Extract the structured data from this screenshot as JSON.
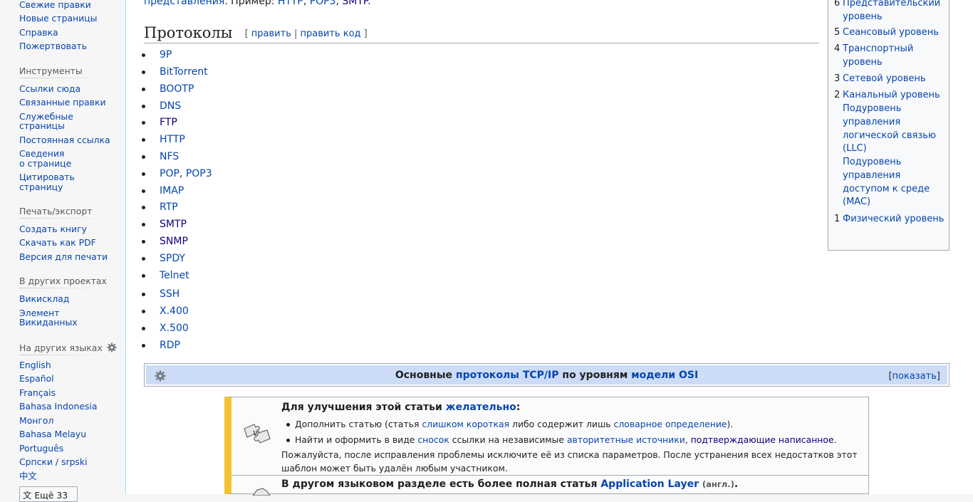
{
  "sidebar": {
    "nav": [
      "Свежие правки",
      "Новые страницы",
      "Справка",
      "Пожертвовать"
    ],
    "tools_heading": "Инструменты",
    "tools": [
      "Ссылки сюда",
      "Связанные правки",
      "Служебные",
      "страницы",
      "Постоянная ссылка",
      "Сведения",
      "о странице",
      "Цитировать",
      "страницу"
    ],
    "print_heading": "Печать/экспорт",
    "print": [
      "Создать книгу",
      "Скачать как PDF",
      "Версия для печати"
    ],
    "projects_heading": "В других проектах",
    "projects": [
      "Викисклад",
      "Элемент",
      "Викиданных"
    ],
    "languages_heading": "На других языках",
    "languages": [
      "English",
      "Español",
      "Français",
      "Bahasa Indonesia",
      "Монгол",
      "Bahasa Melayu",
      "Português",
      "Српски / srpski",
      "中文"
    ],
    "more_languages": "Ещё 33"
  },
  "intro": {
    "link1": "представления",
    "text": ". Пример: ",
    "link2": "HTTP",
    "sep1": ", ",
    "link3": "POP3",
    "sep2": ", ",
    "link4": "SMTP",
    "end": "."
  },
  "section": {
    "title": "Протоколы",
    "edit_open": "[ ",
    "edit": "править",
    "edit_sep": " | ",
    "edit_code": "править код",
    "edit_close": " ]"
  },
  "protocols": [
    "9P",
    "BitTorrent",
    "BOOTP",
    "DNS",
    "FTP",
    "HTTP",
    "NFS",
    "POP",
    "POP3",
    "IMAP",
    "RTP",
    "SMTP",
    "SNMP",
    "SPDY",
    "Telnet",
    "SSH",
    "X.400",
    "X.500",
    "RDP"
  ],
  "toc": {
    "items": [
      {
        "num": "6",
        "lines": [
          "Представительский",
          "уровень"
        ]
      },
      {
        "num": "5",
        "lines": [
          "Сеансовый уровень"
        ]
      },
      {
        "num": "4",
        "lines": [
          "Транспортный",
          "уровень"
        ]
      },
      {
        "num": "3",
        "lines": [
          "Сетевой уровень"
        ]
      },
      {
        "num": "2",
        "lines": [
          "Канальный уровень"
        ]
      },
      {
        "num": "1",
        "lines": [
          "Физический уровень"
        ]
      }
    ],
    "sub1": [
      "Подуровень",
      "управления",
      "логической связью",
      "(LLC)"
    ],
    "sub2": [
      "Подуровень",
      "управления",
      "доступом к среде",
      "(MAC)"
    ]
  },
  "navbox": {
    "prefix": "Основные ",
    "link1": "протоколы TCP/IP",
    "mid": " по уровням ",
    "link2": "модели OSI",
    "show": "показать",
    "show_open": "[",
    "show_close": "]"
  },
  "ambox": {
    "title_prefix": "Для улучшения этой статьи ",
    "title_link": "желательно",
    "title_suffix": ":",
    "li1_a": "Дополнить статью (статья ",
    "li1_link": "слишком короткая",
    "li1_b": " либо содержит лишь ",
    "li1_link2": "словарное определение",
    "li1_c": ").",
    "li2_a": "Найти и оформить в виде ",
    "li2_link": "сносок",
    "li2_b": " ссылки на независимые ",
    "li2_link2": "авторитетные источники",
    "li2_c": ", ",
    "li2_link3": "подтверждающие написанное",
    "li2_d": ".",
    "para": "Пожалуйста, после исправления проблемы исключите её из списка параметров. После устранения всех недостатков этот шаблон может быть удалён любым участником.",
    "row2_prefix": "В другом языковом разделе есть более полная статья ",
    "row2_link": "Application Layer",
    "row2_lang": "(англ.)",
    "row2_end": "."
  },
  "colors": {
    "link": "#0645ad",
    "visited": "#0b0080",
    "ambox_accent": "#f4c430",
    "navbox_bg": "#ccdcf7"
  }
}
